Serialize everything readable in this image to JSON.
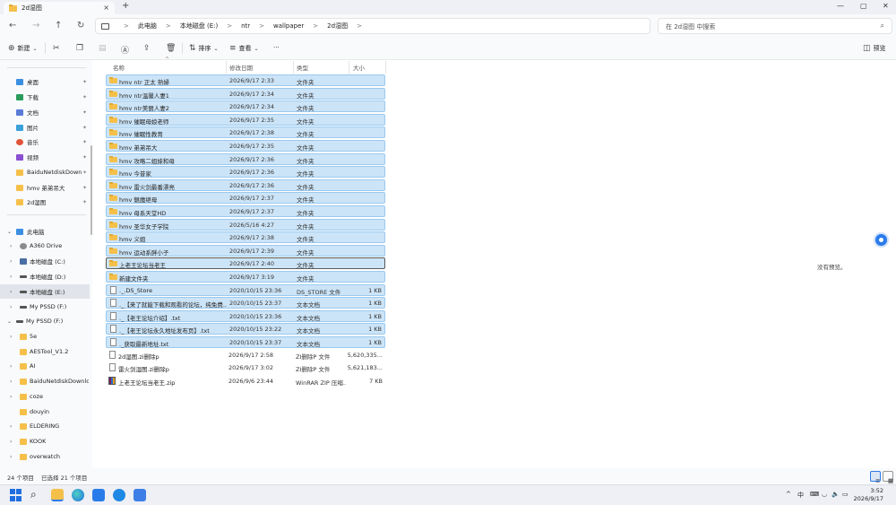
{
  "window": {
    "tab_title": "2d湿图",
    "tab_close": "×",
    "tab_add": "+",
    "minimize": "—",
    "maximize": "▢",
    "close": "✕"
  },
  "nav": {
    "back": "←",
    "forward": "→",
    "up": "↑",
    "refresh": "↻"
  },
  "breadcrumb": [
    "此电脑",
    "本地磁盘 (E:)",
    "ntr",
    "wallpaper",
    "2d湿图"
  ],
  "breadcrumb_sep": ">",
  "search": {
    "placeholder": "在 2d湿图 中搜索",
    "icon": "⌕"
  },
  "toolbar": {
    "new_label": "新建",
    "sort_label": "排序",
    "view_label": "查看",
    "more_label": "···",
    "preview_label": "预览"
  },
  "sidebar": {
    "quick": [
      {
        "label": "桌面",
        "icon_color": "#3b8fe0"
      },
      {
        "label": "下载",
        "icon_color": "#2a9d5c"
      },
      {
        "label": "文档",
        "icon_color": "#5a7bd6"
      },
      {
        "label": "图片",
        "icon_color": "#3aa0d8"
      },
      {
        "label": "音乐",
        "icon_color": "#e0533a"
      },
      {
        "label": "视频",
        "icon_color": "#8a4fd0"
      },
      {
        "label": "BaiduNetdiskDownload",
        "icon_color": "#f5c04a"
      },
      {
        "label": "hmv 弟弟吊大",
        "icon_color": "#f5c04a"
      },
      {
        "label": "2d湿图",
        "icon_color": "#f5c04a"
      }
    ],
    "pin": "📌",
    "this_pc": "此电脑",
    "drives": [
      {
        "label": "A360 Drive"
      },
      {
        "label": "本地磁盘 (C:)"
      },
      {
        "label": "本地磁盘 (D:)"
      },
      {
        "label": "本地磁盘 (E:)"
      },
      {
        "label": "My PSSD (F:)"
      }
    ],
    "pssd": "My PSSD (F:)",
    "pssd_folders": [
      "5e",
      "AESTool_V1.2",
      "AI",
      "BaiduNetdiskDownload",
      "coze",
      "douyin",
      "ELDERING",
      "KOOK",
      "overwatch"
    ]
  },
  "columns": {
    "name": "名称",
    "date": "修改日期",
    "type": "类型",
    "size": "大小"
  },
  "files": [
    {
      "name": "hmv ntr 正太 熟婦",
      "date": "2026/9/17 2:33",
      "type": "文件夹",
      "size": "",
      "kind": "folder",
      "state": "sel"
    },
    {
      "name": "hmv ntr温馨人妻1",
      "date": "2026/9/17 2:34",
      "type": "文件夹",
      "size": "",
      "kind": "folder",
      "state": "sel"
    },
    {
      "name": "hmv ntr美丽人妻2",
      "date": "2026/9/17 2:34",
      "type": "文件夹",
      "size": "",
      "kind": "folder",
      "state": "sel"
    },
    {
      "name": "hmv 催眠母娘老师",
      "date": "2026/9/17 2:35",
      "type": "文件夹",
      "size": "",
      "kind": "folder",
      "state": "sel"
    },
    {
      "name": "hmv 催眠性教育",
      "date": "2026/9/17 2:38",
      "type": "文件夹",
      "size": "",
      "kind": "folder",
      "state": "sel"
    },
    {
      "name": "hmv 弟弟吊大",
      "date": "2026/9/17 2:35",
      "type": "文件夹",
      "size": "",
      "kind": "folder",
      "state": "sel"
    },
    {
      "name": "hmv 攻略二姐妹和母",
      "date": "2026/9/17 2:36",
      "type": "文件夹",
      "size": "",
      "kind": "folder",
      "state": "sel"
    },
    {
      "name": "hmv 今昔家",
      "date": "2026/9/17 2:36",
      "type": "文件夹",
      "size": "",
      "kind": "folder",
      "state": "sel"
    },
    {
      "name": "hmv 雷火剑最番漂亮",
      "date": "2026/9/17 2:36",
      "type": "文件夹",
      "size": "",
      "kind": "folder",
      "state": "sel"
    },
    {
      "name": "hmv 魅魔继母",
      "date": "2026/9/17 2:37",
      "type": "文件夹",
      "size": "",
      "kind": "folder",
      "state": "sel"
    },
    {
      "name": "hmv 母系天堂HD",
      "date": "2026/9/17 2:37",
      "type": "文件夹",
      "size": "",
      "kind": "folder",
      "state": "sel"
    },
    {
      "name": "hmv 圣华女子学院",
      "date": "2026/5/16 4:27",
      "type": "文件夹",
      "size": "",
      "kind": "folder",
      "state": "sel"
    },
    {
      "name": "hmv 义姐",
      "date": "2026/9/17 2:38",
      "type": "文件夹",
      "size": "",
      "kind": "folder",
      "state": "sel"
    },
    {
      "name": "hmv 运动系胖小子",
      "date": "2026/9/17 2:39",
      "type": "文件夹",
      "size": "",
      "kind": "folder",
      "state": "sel"
    },
    {
      "name": "上老王论坛当老王",
      "date": "2026/9/17 2:40",
      "type": "文件夹",
      "size": "",
      "kind": "folder",
      "state": "focus"
    },
    {
      "name": "新建文件夹",
      "date": "2026/9/17 3:19",
      "type": "文件夹",
      "size": "",
      "kind": "folder",
      "state": "sel"
    },
    {
      "name": "._.DS_Store",
      "date": "2020/10/15 23:36",
      "type": "DS_STORE 文件",
      "size": "1 KB",
      "kind": "doc",
      "state": "sel"
    },
    {
      "name": "._【来了就能下载和观看的论坛，纯免费...",
      "date": "2020/10/15 23:37",
      "type": "文本文档",
      "size": "1 KB",
      "kind": "doc",
      "state": "sel"
    },
    {
      "name": "._【老王论坛介绍】.txt",
      "date": "2020/10/15 23:36",
      "type": "文本文档",
      "size": "1 KB",
      "kind": "doc",
      "state": "sel"
    },
    {
      "name": "._【老王论坛永久地址发布页】.txt",
      "date": "2020/10/15 23:22",
      "type": "文本文档",
      "size": "1 KB",
      "kind": "doc",
      "state": "sel"
    },
    {
      "name": "._获取最新地址.txt",
      "date": "2020/10/15 23:37",
      "type": "文本文档",
      "size": "1 KB",
      "kind": "doc",
      "state": "sel"
    },
    {
      "name": "2d湿图.zi删除p",
      "date": "2026/9/17 2:58",
      "type": "ZI删除P 文件",
      "size": "5,620,335...",
      "kind": "doc",
      "state": ""
    },
    {
      "name": "雷火剑湿图.zi删除p",
      "date": "2026/9/17 3:02",
      "type": "ZI删除P 文件",
      "size": "5,621,183...",
      "kind": "doc",
      "state": ""
    },
    {
      "name": "上老王论坛当老王.zip",
      "date": "2026/9/6 23:44",
      "type": "WinRAR ZIP 压缩...",
      "size": "7 KB",
      "kind": "zip",
      "state": ""
    }
  ],
  "preview_text": "没有预览。",
  "status": {
    "count": "24 个项目",
    "selected": "已选择 21 个项目"
  },
  "taskbar": {
    "tray_up": "^",
    "ime": "中",
    "clock_time": "3:52",
    "clock_date": "2026/9/17"
  }
}
